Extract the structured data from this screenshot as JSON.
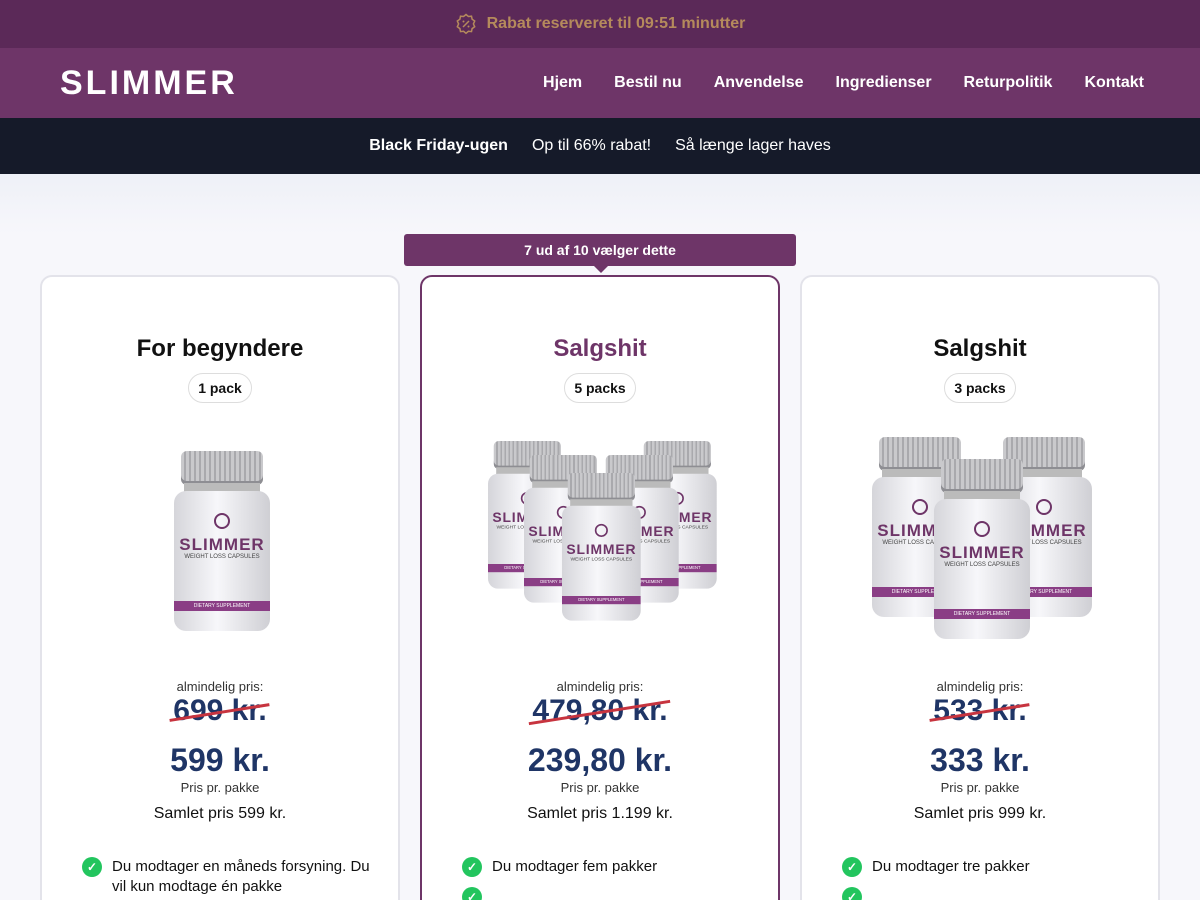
{
  "topbar": {
    "text": "Rabat reserveret til 09:51 minutter",
    "icon": "discount-badge-icon"
  },
  "header": {
    "logo": "SLIMMER",
    "nav": [
      "Hjem",
      "Bestil nu",
      "Anvendelse",
      "Ingredienser",
      "Returpolitik",
      "Kontakt"
    ]
  },
  "promo": {
    "item1": "Black Friday-ugen",
    "item2": "Op til 66% rabat!",
    "item3": "Så længe lager haves"
  },
  "ribbon": "7 ud af 10 vælger dette",
  "colors": {
    "brand": "#6e3568",
    "topbar": "#5b2958",
    "price": "#1f3566",
    "strike": "#c7343f",
    "check": "#22c55e"
  },
  "product": {
    "brand": "SLIMMER",
    "subtitle": "WEIGHT LOSS CAPSULES",
    "band": "DIETARY SUPPLEMENT"
  },
  "cards": [
    {
      "title": "For begyndere",
      "pack": "1 pack",
      "regular_label": "almindelig pris:",
      "old_price": "699 kr.",
      "price": "599 kr.",
      "per_label": "Pris pr. pakke",
      "total": "Samlet pris 599 kr.",
      "features": [
        "Du modtager en måneds forsyning. Du vil kun modtage én pakke"
      ]
    },
    {
      "title": "Salgshit",
      "pack": "5 packs",
      "regular_label": "almindelig pris:",
      "old_price": "479,80 kr.",
      "price": "239,80 kr.",
      "per_label": "Pris pr. pakke",
      "total": "Samlet pris 1.199 kr.",
      "features": [
        "Du modtager fem pakker"
      ]
    },
    {
      "title": "Salgshit",
      "pack": "3 packs",
      "regular_label": "almindelig pris:",
      "old_price": "533 kr.",
      "price": "333 kr.",
      "per_label": "Pris pr. pakke",
      "total": "Samlet pris 999 kr.",
      "features": [
        "Du modtager tre pakker"
      ]
    }
  ]
}
